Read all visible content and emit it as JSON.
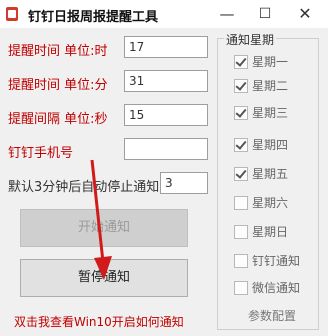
{
  "window": {
    "title": "钉钉日报周报提醒工具",
    "min_label": "—",
    "max_label": "☐",
    "close_label": "✕"
  },
  "form": {
    "hour_label": "提醒时间 单位:时",
    "hour_value": "17",
    "minute_label": "提醒时间 单位:分",
    "minute_value": "31",
    "interval_label": "提醒间隔 单位:秒",
    "interval_value": "15",
    "phone_label": "钉钉手机号",
    "phone_value": "",
    "auto_stop_label": "默认3分钟后自动停止通知",
    "auto_stop_value": "3"
  },
  "buttons": {
    "start_label": "开始通知",
    "stop_label": "暂停通知"
  },
  "help_link": "双击我查看Win10开启如何通知",
  "weekdays": {
    "group_title": "通知星期",
    "items": [
      {
        "label": "星期一",
        "checked": true
      },
      {
        "label": "星期二",
        "checked": true
      },
      {
        "label": "星期三",
        "checked": true
      },
      {
        "label": "星期四",
        "checked": true
      },
      {
        "label": "星期五",
        "checked": true
      },
      {
        "label": "星期六",
        "checked": false
      },
      {
        "label": "星期日",
        "checked": false
      }
    ]
  },
  "options": {
    "dingtalk_notify": "钉钉通知",
    "wechat_notify": "微信通知",
    "config_button": "参数配置"
  },
  "colors": {
    "label_red": "#c00000",
    "arrow_red": "#d11a1a"
  }
}
